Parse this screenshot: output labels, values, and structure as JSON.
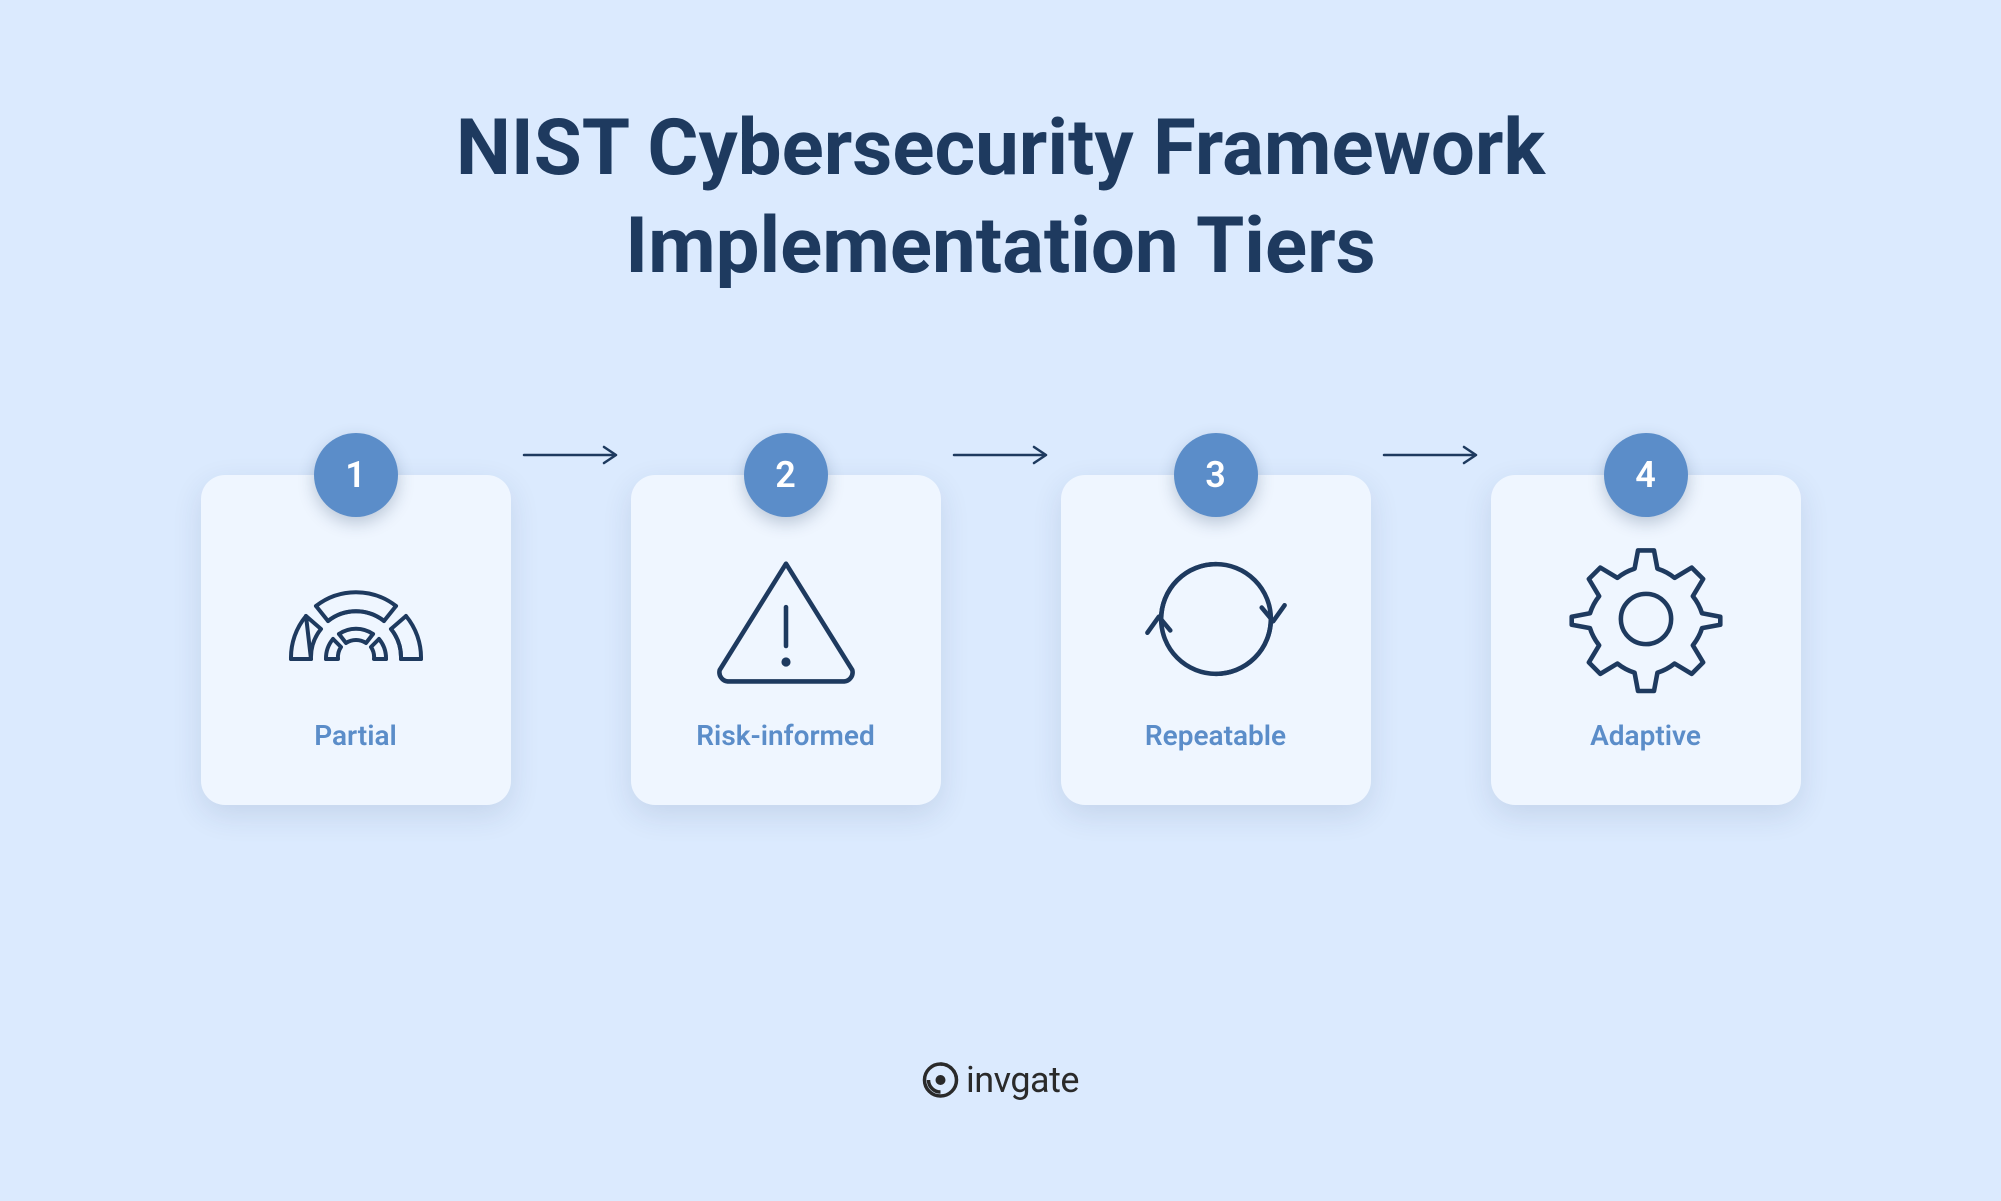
{
  "title_line1": "NIST Cybersecurity Framework",
  "title_line2": "Implementation Tiers",
  "tiers": [
    {
      "number": "1",
      "label": "Partial"
    },
    {
      "number": "2",
      "label": "Risk-informed"
    },
    {
      "number": "3",
      "label": "Repeatable"
    },
    {
      "number": "4",
      "label": "Adaptive"
    }
  ],
  "brand": "invgate",
  "colors": {
    "background": "#dbeafe",
    "card_background": "#eff6ff",
    "title": "#1e3a5f",
    "accent": "#5b8dc9",
    "icon_stroke": "#1e3a5f"
  }
}
